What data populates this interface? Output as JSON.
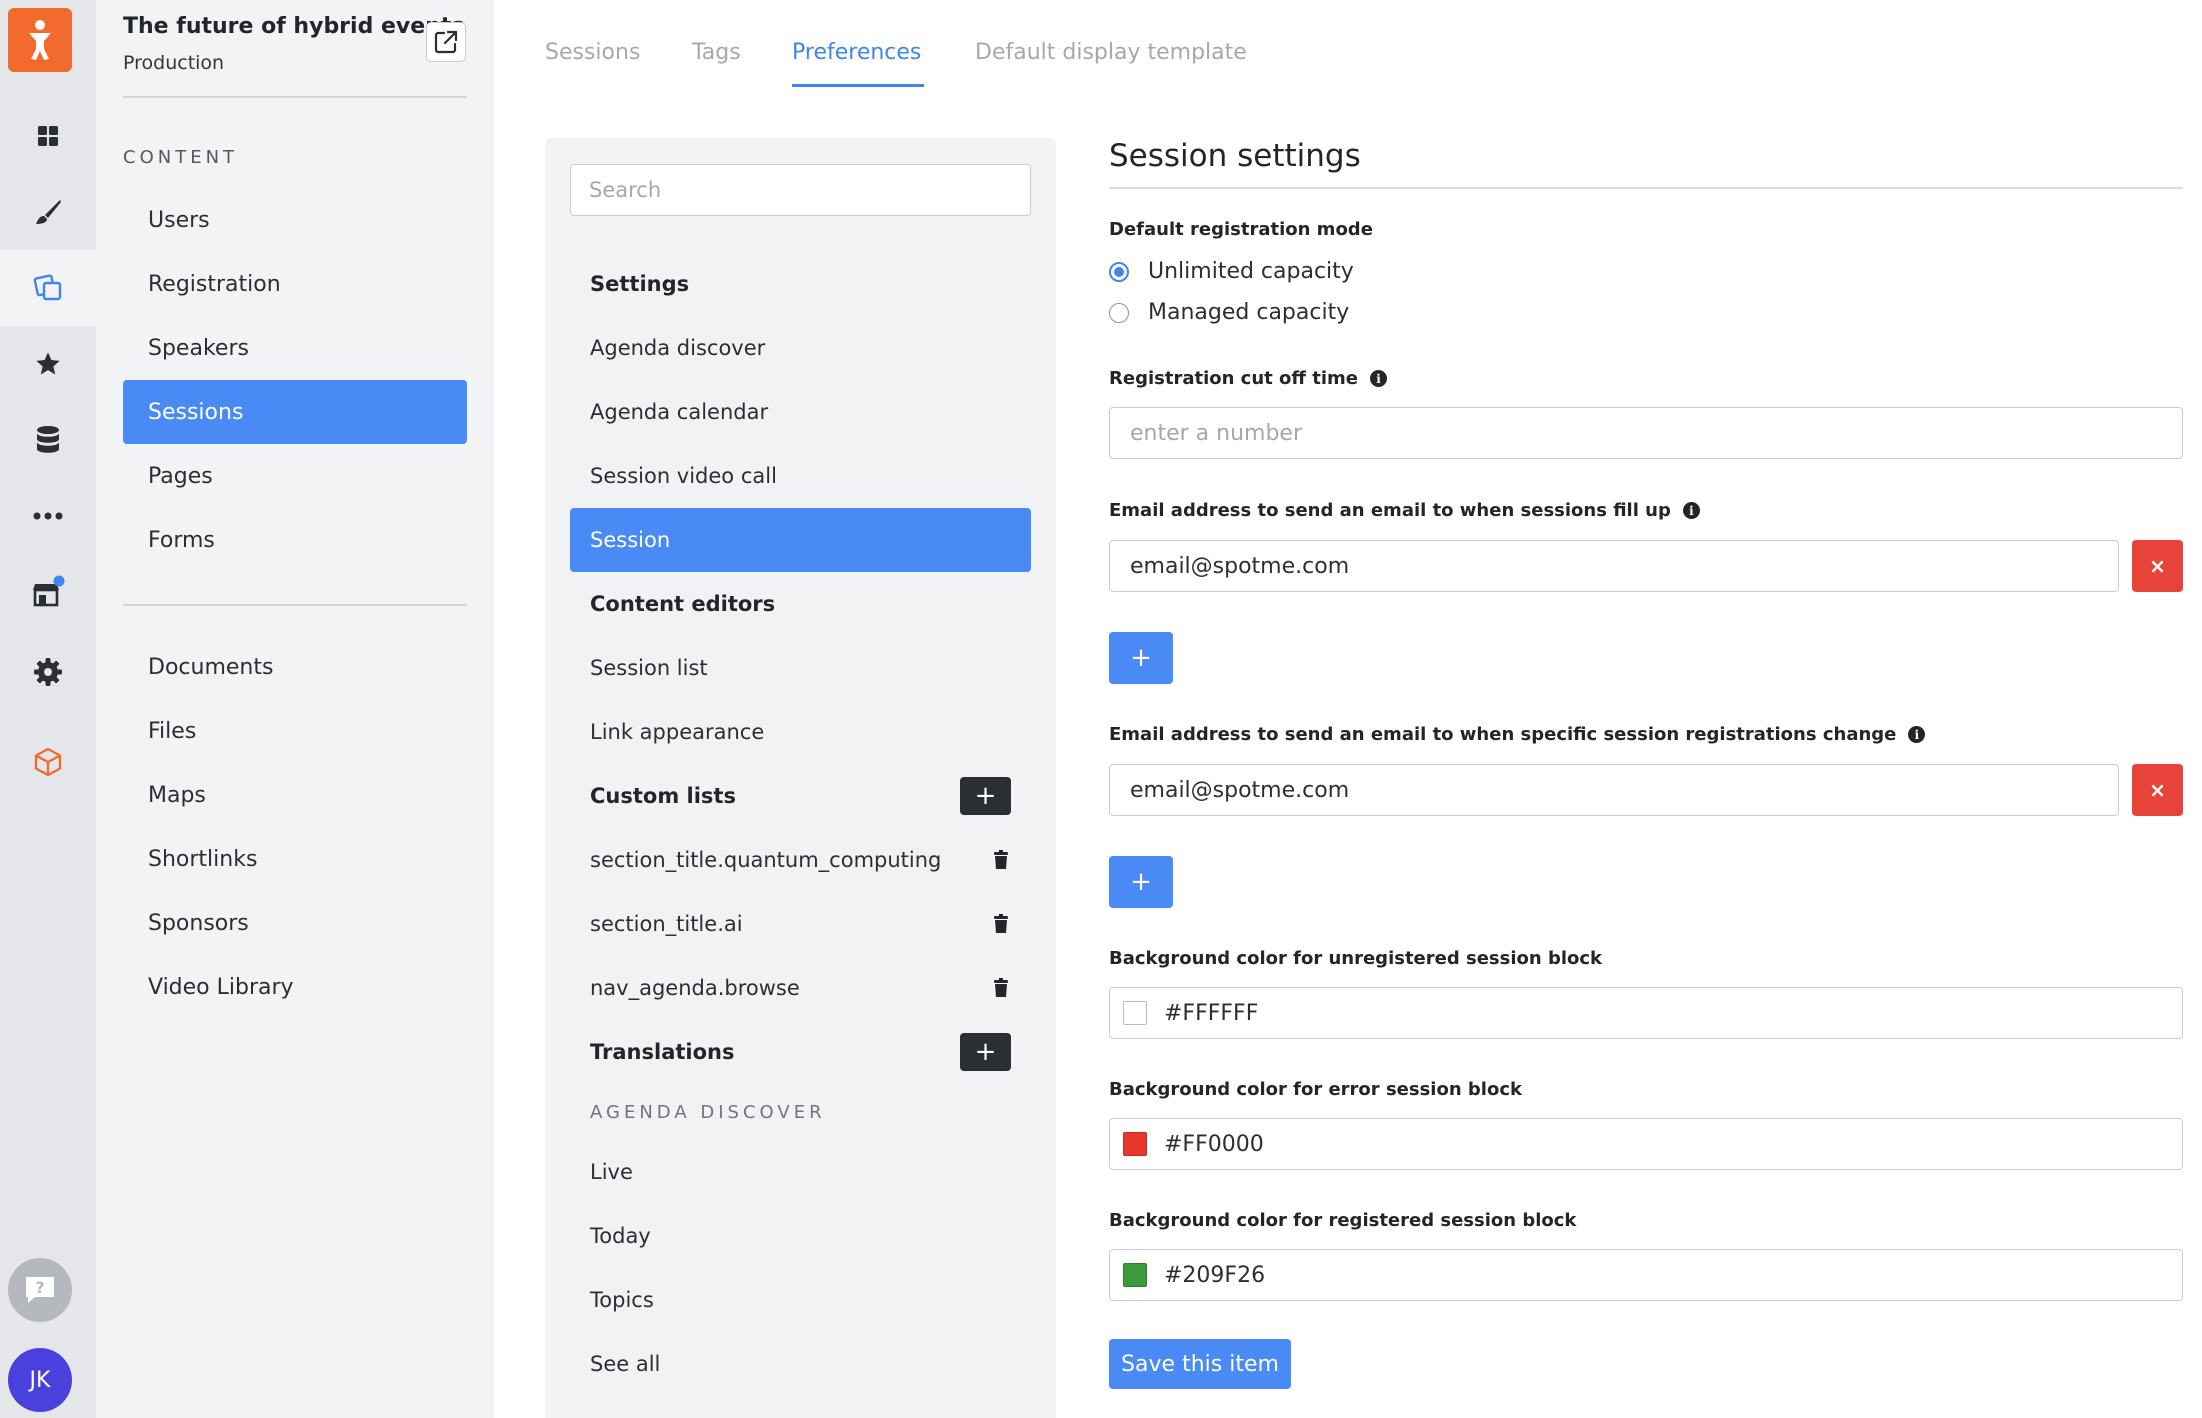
{
  "event": {
    "title": "The future of hybrid events",
    "environment": "Production"
  },
  "rail": {
    "icons": [
      "person-logo-icon",
      "dashboard-icon",
      "brush-icon",
      "content-icon",
      "star-icon",
      "database-icon",
      "more-icon",
      "store-icon",
      "gear-icon",
      "package-icon"
    ],
    "help_icon": "help-icon",
    "avatar": "JK",
    "logo_color": "#F26A2E",
    "notification_color": "#3F86F0"
  },
  "nav": {
    "heading": "CONTENT",
    "items": [
      "Users",
      "Registration",
      "Speakers",
      "Sessions",
      "Pages",
      "Forms"
    ],
    "secondary_items": [
      "Documents",
      "Files",
      "Maps",
      "Shortlinks",
      "Sponsors",
      "Video Library"
    ],
    "active": "Sessions"
  },
  "tabs": [
    {
      "label": "Sessions"
    },
    {
      "label": "Tags"
    },
    {
      "label": "Preferences"
    },
    {
      "label": "Default display template"
    }
  ],
  "active_tab": "Preferences",
  "middle": {
    "search_placeholder": "Search",
    "settings_title": "Settings",
    "settings_items": [
      "Agenda discover",
      "Agenda calendar",
      "Session video call",
      "Session"
    ],
    "active_item": "Session",
    "content_editors_title": "Content editors",
    "content_editors_items": [
      "Session list",
      "Link appearance"
    ],
    "custom_lists_title": "Custom lists",
    "custom_lists_items": [
      "section_title.quantum_computing",
      "section_title.ai",
      "nav_agenda.browse"
    ],
    "translations_title": "Translations",
    "agenda_discover_heading": "AGENDA DISCOVER",
    "agenda_discover_items": [
      "Live",
      "Today",
      "Topics",
      "See all"
    ],
    "add_label": "+"
  },
  "form": {
    "title": "Session settings",
    "registration_mode_label": "Default registration mode",
    "registration_modes": [
      "Unlimited capacity",
      "Managed capacity"
    ],
    "registration_mode_selected": "Unlimited capacity",
    "cutoff_label": "Registration cut off time",
    "cutoff_placeholder": "enter a number",
    "cutoff_value": "",
    "fill_email_label": "Email address to send an email to when sessions fill up",
    "fill_email_value": "email@spotme.com",
    "change_email_label": "Email address to send an email to when specific session registrations change",
    "change_email_value": "email@spotme.com",
    "remove_label": "×",
    "add_label": "+",
    "unregistered_color_label": "Background color for unregistered session block",
    "unregistered_color": "#FFFFFF",
    "error_color_label": "Background color for error session block",
    "error_color": "#FF0000",
    "registered_color_label": "Background color for registered session block",
    "registered_color": "#209F26",
    "save_label": "Save this item"
  },
  "colors": {
    "accent": "#4A8AF4",
    "danger": "#E7433A",
    "dark_button": "#2B2F34"
  }
}
